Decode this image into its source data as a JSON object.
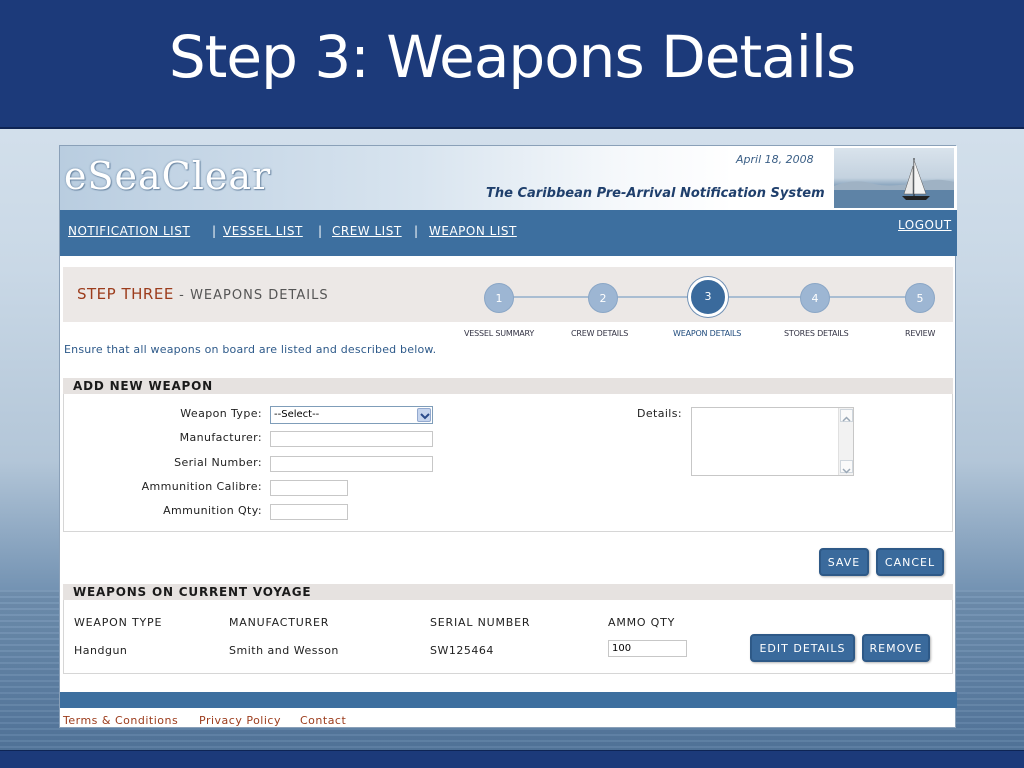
{
  "slide": {
    "title": "Step 3: Weapons Details"
  },
  "app": {
    "logo": "eSeaClear",
    "date": "April 18, 2008",
    "tagline": "The Caribbean Pre-Arrival Notification System"
  },
  "nav": {
    "items": [
      "NOTIFICATION LIST",
      "VESSEL LIST",
      "CREW LIST",
      "WEAPON LIST"
    ],
    "logout": "LOGOUT"
  },
  "steps": {
    "heading": "STEP THREE",
    "heading_sep": "-",
    "heading_sub": "WEAPONS DETAILS",
    "items": [
      {
        "number": "1",
        "label": "VESSEL SUMMARY"
      },
      {
        "number": "2",
        "label": "CREW DETAILS"
      },
      {
        "number": "3",
        "label": "WEAPON DETAILS",
        "active": true
      },
      {
        "number": "4",
        "label": "STORES DETAILS"
      },
      {
        "number": "5",
        "label": "REVIEW"
      }
    ]
  },
  "intro": "Ensure that all weapons on board are listed and described below.",
  "add_weapon": {
    "heading": "ADD NEW WEAPON",
    "weapon_type_label": "Weapon Type:",
    "weapon_type_value": "--Select--",
    "manufacturer_label": "Manufacturer:",
    "serial_label": "Serial Number:",
    "calibre_label": "Ammunition Calibre:",
    "qty_label": "Ammunition Qty:",
    "details_label": "Details:",
    "save": "SAVE",
    "cancel": "CANCEL"
  },
  "voyage": {
    "heading": "WEAPONS ON CURRENT VOYAGE",
    "columns": [
      "WEAPON TYPE",
      "MANUFACTURER",
      "SERIAL NUMBER",
      "AMMO QTY"
    ],
    "rows": [
      {
        "type": "Handgun",
        "manufacturer": "Smith and Wesson",
        "serial": "SW125464",
        "ammo_qty": "100"
      }
    ],
    "edit": "EDIT DETAILS",
    "remove": "REMOVE"
  },
  "footer": {
    "links": [
      "Terms & Conditions",
      "Privacy Policy",
      "Contact"
    ]
  },
  "colors": {
    "slide_bar": "#1c3a7a",
    "nav_bar": "#3d6f9f",
    "button": "#3a6a9c",
    "heading_accent": "#9c3c1c"
  }
}
